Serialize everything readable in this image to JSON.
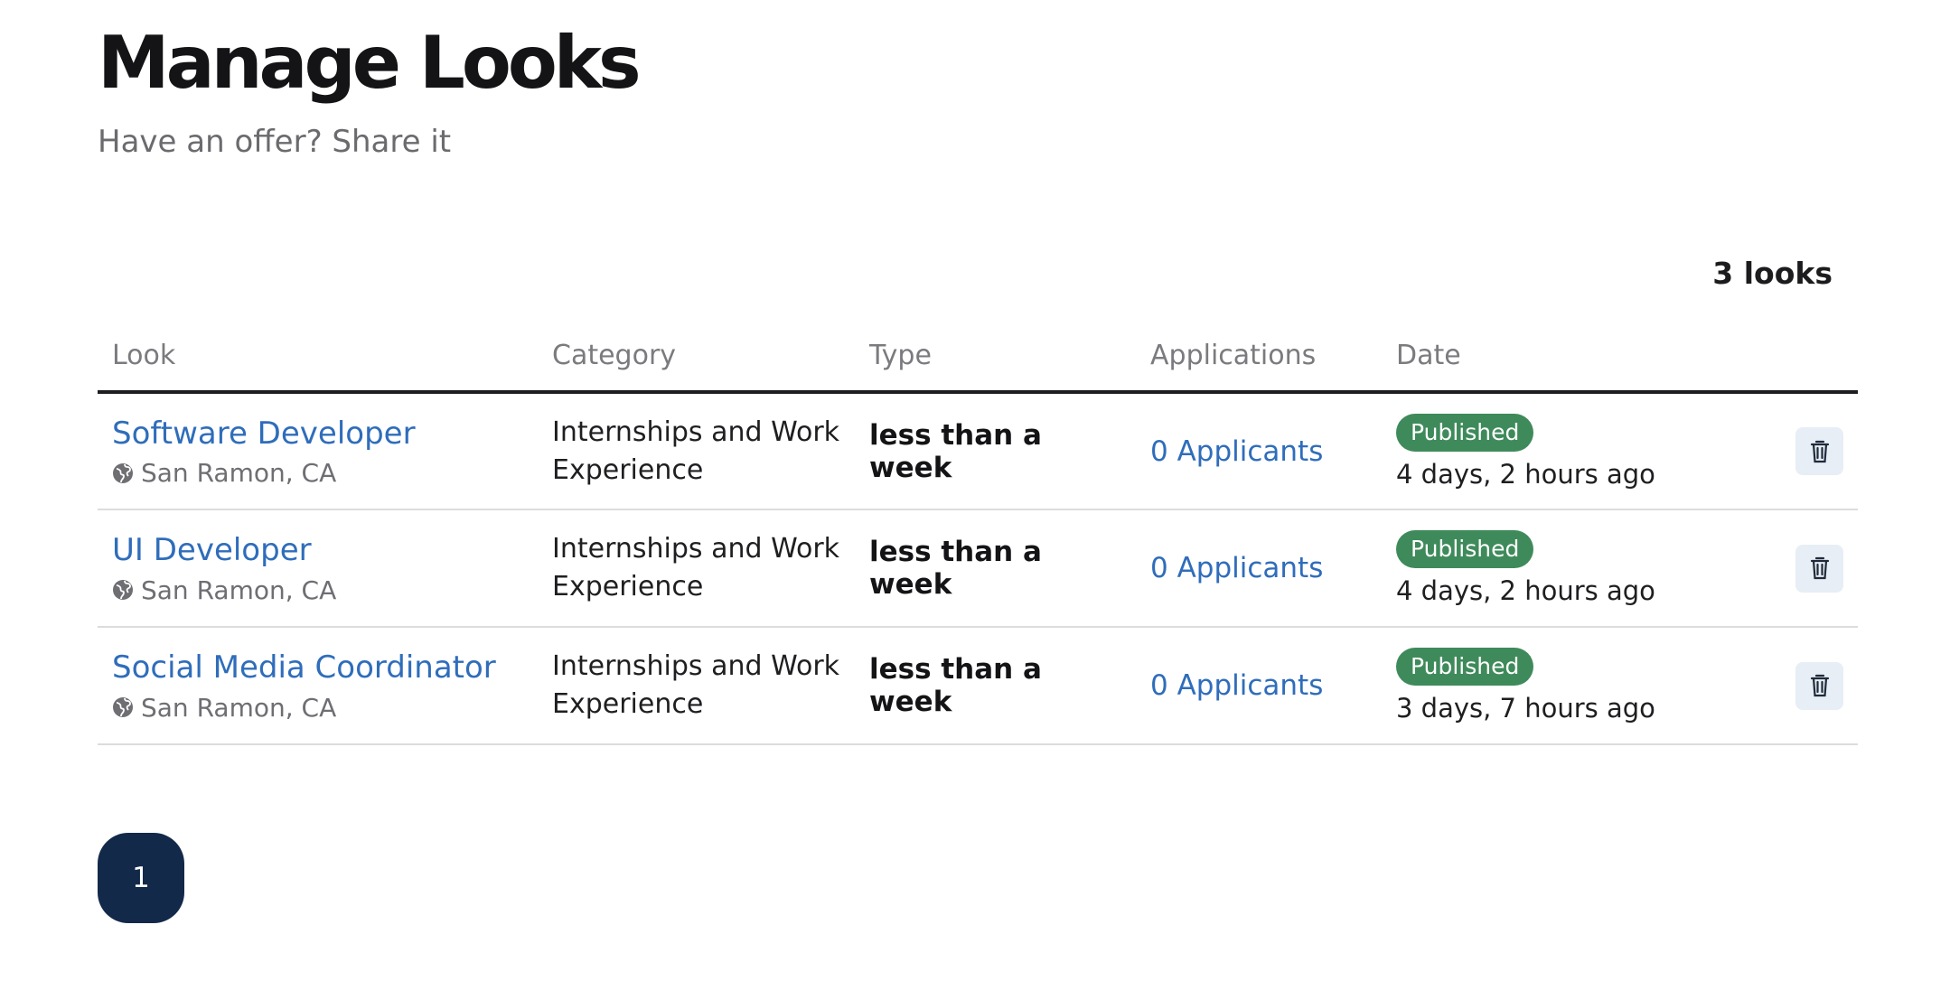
{
  "header": {
    "title": "Manage Looks",
    "subtitle": "Have an offer? Share it"
  },
  "summary": {
    "count_label": "3 looks"
  },
  "table": {
    "columns": [
      "Look",
      "Category",
      "Type",
      "Applications",
      "Date",
      ""
    ],
    "rows": [
      {
        "title": "Software Developer",
        "location": "San Ramon, CA",
        "category": "Internships and Work Experience",
        "type": "less than a week",
        "applications": "0 Applicants",
        "status": "Published",
        "posted": "4 days, 2 hours ago"
      },
      {
        "title": "UI Developer",
        "location": "San Ramon, CA",
        "category": "Internships and Work Experience",
        "type": "less than a week",
        "applications": "0 Applicants",
        "status": "Published",
        "posted": "4 days, 2 hours ago"
      },
      {
        "title": "Social Media Coordinator",
        "location": "San Ramon, CA",
        "category": "Internships and Work Experience",
        "type": "less than a week",
        "applications": "0 Applicants",
        "status": "Published",
        "posted": "3 days, 7 hours ago"
      }
    ]
  },
  "pagination": {
    "current_page": "1"
  },
  "icons": {
    "location": "globe-icon",
    "delete": "trash-icon"
  },
  "colors": {
    "link": "#2f6dbb",
    "status_published": "#3f8a5b",
    "pager": "#13294a",
    "delete_bg": "#e7eef5"
  }
}
